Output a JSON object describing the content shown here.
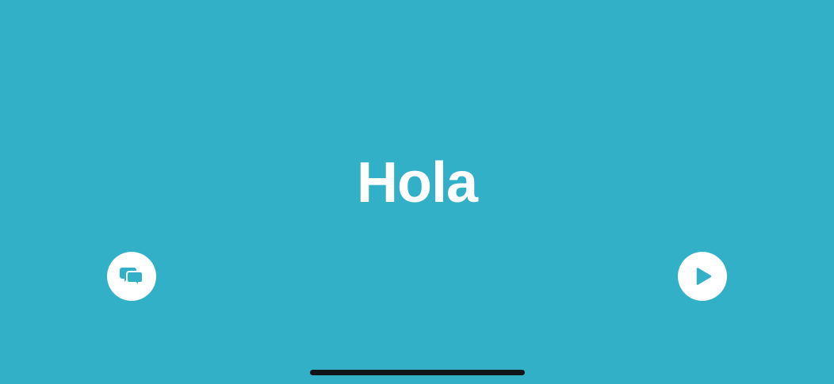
{
  "card": {
    "word": "Hola",
    "background_color": "#31b0c7"
  },
  "controls": {
    "left_button_icon": "speech-bubbles-icon",
    "right_button_icon": "play-icon",
    "icon_color": "#31b0c7",
    "button_color": "#ffffff"
  },
  "home_indicator": {
    "color": "#111418"
  }
}
